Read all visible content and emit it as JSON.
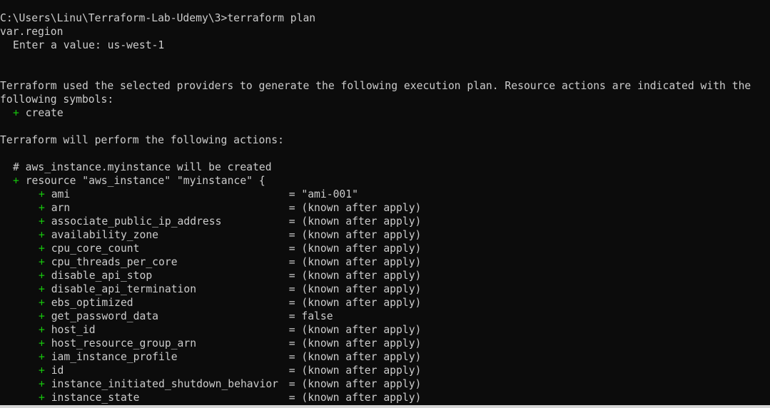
{
  "prompt_line": "C:\\Users\\Linu\\Terraform-Lab-Udemy\\3>terraform plan",
  "var_line": "var.region",
  "enter_value_line": "Enter a value: us-west-1",
  "intro_line_1": "Terraform used the selected providers to generate the following execution plan. Resource actions are indicated with the",
  "intro_line_2": "following symbols:",
  "symbol_plus": "+",
  "symbol_create": "create",
  "perform_line": "Terraform will perform the following actions:",
  "comment_line": "# aws_instance.myinstance will be created",
  "resource_line": "resource \"aws_instance\" \"myinstance\" {",
  "attributes": [
    {
      "name": "ami",
      "value": "= \"ami-001\""
    },
    {
      "name": "arn",
      "value": "= (known after apply)"
    },
    {
      "name": "associate_public_ip_address",
      "value": "= (known after apply)"
    },
    {
      "name": "availability_zone",
      "value": "= (known after apply)"
    },
    {
      "name": "cpu_core_count",
      "value": "= (known after apply)"
    },
    {
      "name": "cpu_threads_per_core",
      "value": "= (known after apply)"
    },
    {
      "name": "disable_api_stop",
      "value": "= (known after apply)"
    },
    {
      "name": "disable_api_termination",
      "value": "= (known after apply)"
    },
    {
      "name": "ebs_optimized",
      "value": "= (known after apply)"
    },
    {
      "name": "get_password_data",
      "value": "= false"
    },
    {
      "name": "host_id",
      "value": "= (known after apply)"
    },
    {
      "name": "host_resource_group_arn",
      "value": "= (known after apply)"
    },
    {
      "name": "iam_instance_profile",
      "value": "= (known after apply)"
    },
    {
      "name": "id",
      "value": "= (known after apply)"
    },
    {
      "name": "instance_initiated_shutdown_behavior",
      "value": "= (known after apply)"
    },
    {
      "name": "instance_state",
      "value": "= (known after apply)"
    }
  ],
  "colors": {
    "background": "#0c0c0c",
    "text": "#cccccc",
    "plus": "#16c60c"
  }
}
